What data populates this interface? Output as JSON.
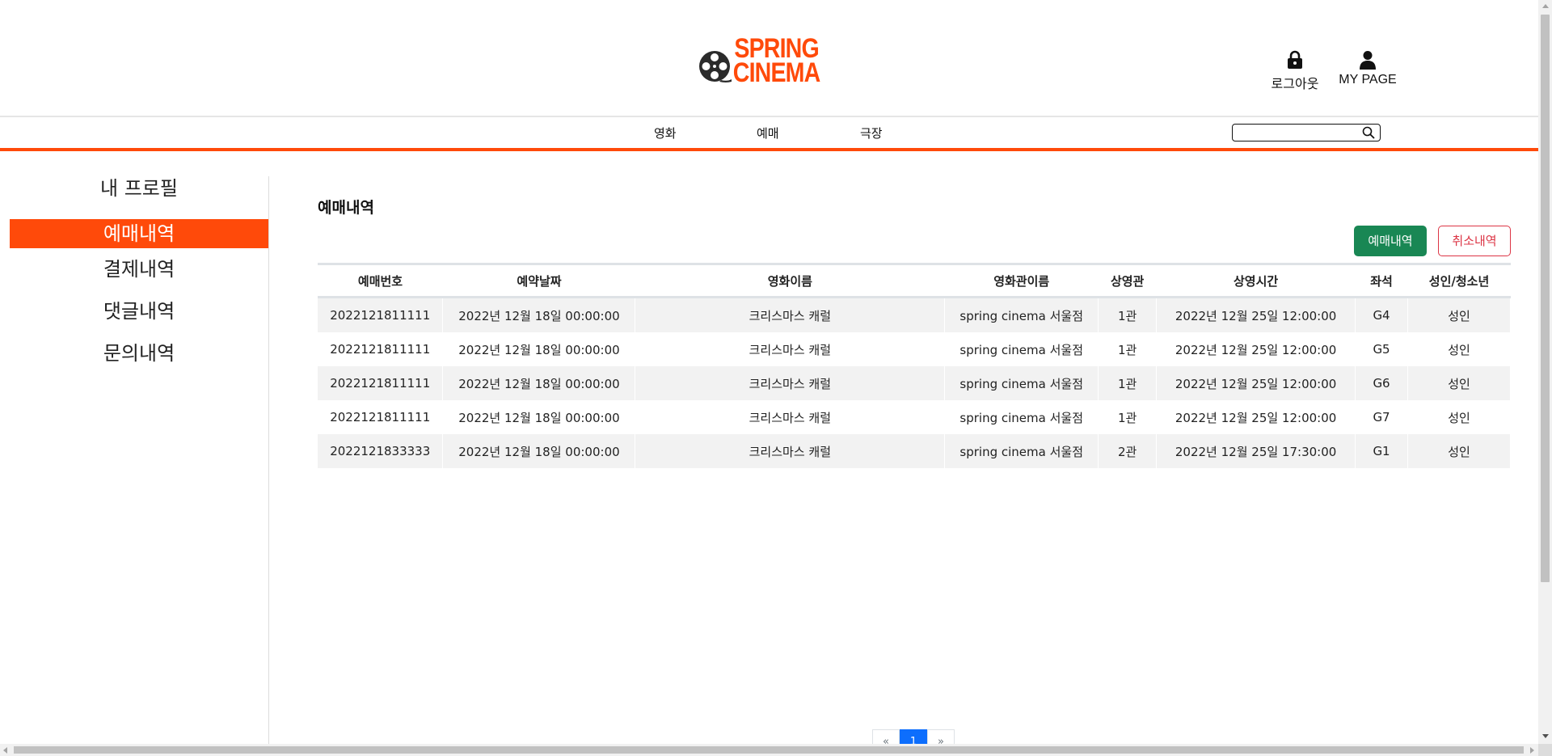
{
  "header": {
    "logo_text": "SPRING CINEMA",
    "logout_label": "로그아웃",
    "mypage_label": "MY PAGE",
    "brand_color": "#ff4a0a"
  },
  "nav": {
    "items": [
      "영화",
      "예매",
      "극장"
    ],
    "search_value": ""
  },
  "sidebar": {
    "items": [
      {
        "label": "내 프로필",
        "active": false
      },
      {
        "label": "예매내역",
        "active": true
      },
      {
        "label": "결제내역",
        "active": false
      },
      {
        "label": "댓글내역",
        "active": false
      },
      {
        "label": "문의내역",
        "active": false
      }
    ]
  },
  "main": {
    "title": "예매내역",
    "buttons": {
      "history": "예매내역",
      "cancel": "취소내역"
    },
    "table": {
      "columns": [
        "예매번호",
        "예약날짜",
        "영화이름",
        "영화관이름",
        "상영관",
        "상영시간",
        "좌석",
        "성인/청소년"
      ],
      "rows": [
        [
          "2022121811111",
          "2022년 12월 18일 00:00:00",
          "크리스마스 캐럴",
          "spring cinema 서울점",
          "1관",
          "2022년 12월 25일 12:00:00",
          "G4",
          "성인"
        ],
        [
          "2022121811111",
          "2022년 12월 18일 00:00:00",
          "크리스마스 캐럴",
          "spring cinema 서울점",
          "1관",
          "2022년 12월 25일 12:00:00",
          "G5",
          "성인"
        ],
        [
          "2022121811111",
          "2022년 12월 18일 00:00:00",
          "크리스마스 캐럴",
          "spring cinema 서울점",
          "1관",
          "2022년 12월 25일 12:00:00",
          "G6",
          "성인"
        ],
        [
          "2022121811111",
          "2022년 12월 18일 00:00:00",
          "크리스마스 캐럴",
          "spring cinema 서울점",
          "1관",
          "2022년 12월 25일 12:00:00",
          "G7",
          "성인"
        ],
        [
          "2022121833333",
          "2022년 12월 18일 00:00:00",
          "크리스마스 캐럴",
          "spring cinema 서울점",
          "2관",
          "2022년 12월 25일 17:30:00",
          "G1",
          "성인"
        ]
      ]
    },
    "pagination": {
      "prev": "«",
      "current": "1",
      "next": "»"
    }
  },
  "icons": {
    "logout": "lock-icon",
    "mypage": "user-icon",
    "search": "search-icon",
    "logo": "film-reel-icon"
  }
}
